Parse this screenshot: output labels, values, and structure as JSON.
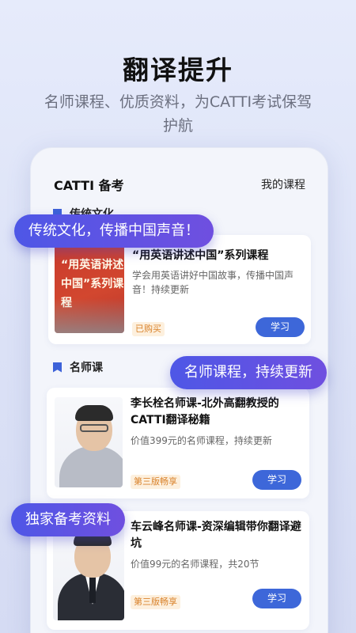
{
  "hero": {
    "title": "翻译提升",
    "subtitle": "名师课程、优质资料，为CATTI考试保驾护航"
  },
  "screen": {
    "title": "CATTI 备考",
    "my_courses": "我的课程"
  },
  "sections": [
    {
      "label": "传统文化",
      "items": [
        {
          "thumb_text": "“用英语讲述中国”系列课程",
          "title": "“用英语讲述中国”系列课程",
          "desc": "学会用英语讲好中国故事，传播中国声音！持续更新",
          "badge": "已购买",
          "button": "学习"
        }
      ]
    },
    {
      "label": "名师课",
      "items": [
        {
          "title": "李长栓名师课-北外高翻教授的CATTI翻译秘籍",
          "desc": "价值399元的名师课程，持续更新",
          "badge": "第三版畅享",
          "button": "学习"
        },
        {
          "title": "车云峰名师课-资深编辑带你翻译避坑",
          "desc": "价值99元的名师课程，共20节",
          "badge": "第三版畅享",
          "button": "学习"
        }
      ]
    }
  ],
  "bubbles": {
    "culture": "传统文化，传播中国声音！",
    "teachers": "名师课程，持续更新",
    "materials": "独家备考资料"
  },
  "colors": {
    "accent": "#3d67d9",
    "bubble_start": "#4e57e6",
    "bubble_end": "#6f4fe0",
    "badge_text": "#d9822b",
    "badge_bg": "#fdf0de"
  }
}
